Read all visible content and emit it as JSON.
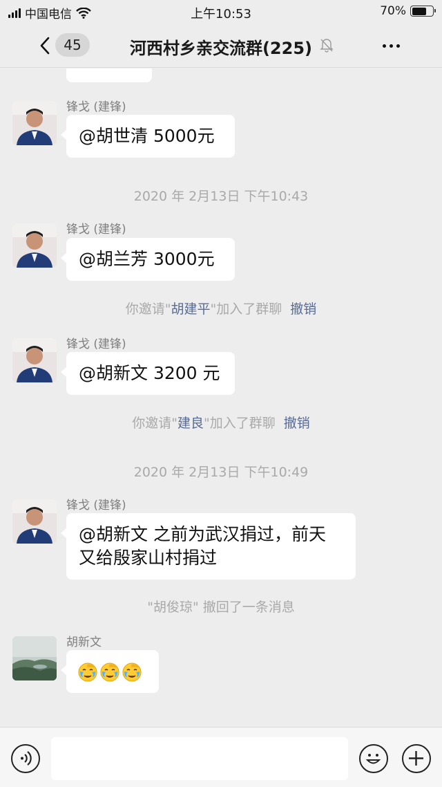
{
  "status_bar": {
    "carrier": "中国电信",
    "time": "上午10:53",
    "battery": "70%",
    "battery_level": 0.7
  },
  "nav": {
    "unread_count": "45",
    "title": "河西村乡亲交流群(225)"
  },
  "messages": [
    {
      "sender": "锋戈 (建锋)",
      "text": "@胡世清 5000元"
    },
    {
      "sender": "锋戈 (建锋)",
      "text": "@胡兰芳 3000元"
    },
    {
      "sender": "锋戈 (建锋)",
      "text": "@胡新文 3200 元"
    },
    {
      "sender": "锋戈 (建锋)",
      "text_line1": "@胡新文 之前为武汉捐过，前天",
      "text_line2": "又给殷家山村捐过"
    },
    {
      "sender": "胡新文",
      "emojis": [
        "facepalm-cry-emoji",
        "facepalm-cry-emoji",
        "facepalm-cry-emoji"
      ]
    }
  ],
  "timestamps": [
    "2020 年 2月13日 下午10:43",
    "2020 年 2月13日 下午10:49"
  ],
  "system": [
    {
      "prefix": "你邀请\"",
      "name": "胡建平",
      "suffix": "\"加入了群聊",
      "action": "撤销"
    },
    {
      "prefix": "你邀请\"",
      "name": "建良",
      "suffix": "\"加入了群聊",
      "action": "撤销"
    },
    {
      "text": "\"胡俊琼\" 撤回了一条消息"
    }
  ],
  "input": {
    "value": ""
  },
  "icons": [
    "signal-icon",
    "wifi-icon",
    "battery-icon",
    "back-icon",
    "mute-bell-icon",
    "more-icon",
    "voice-icon",
    "emoji-icon",
    "plus-icon"
  ]
}
